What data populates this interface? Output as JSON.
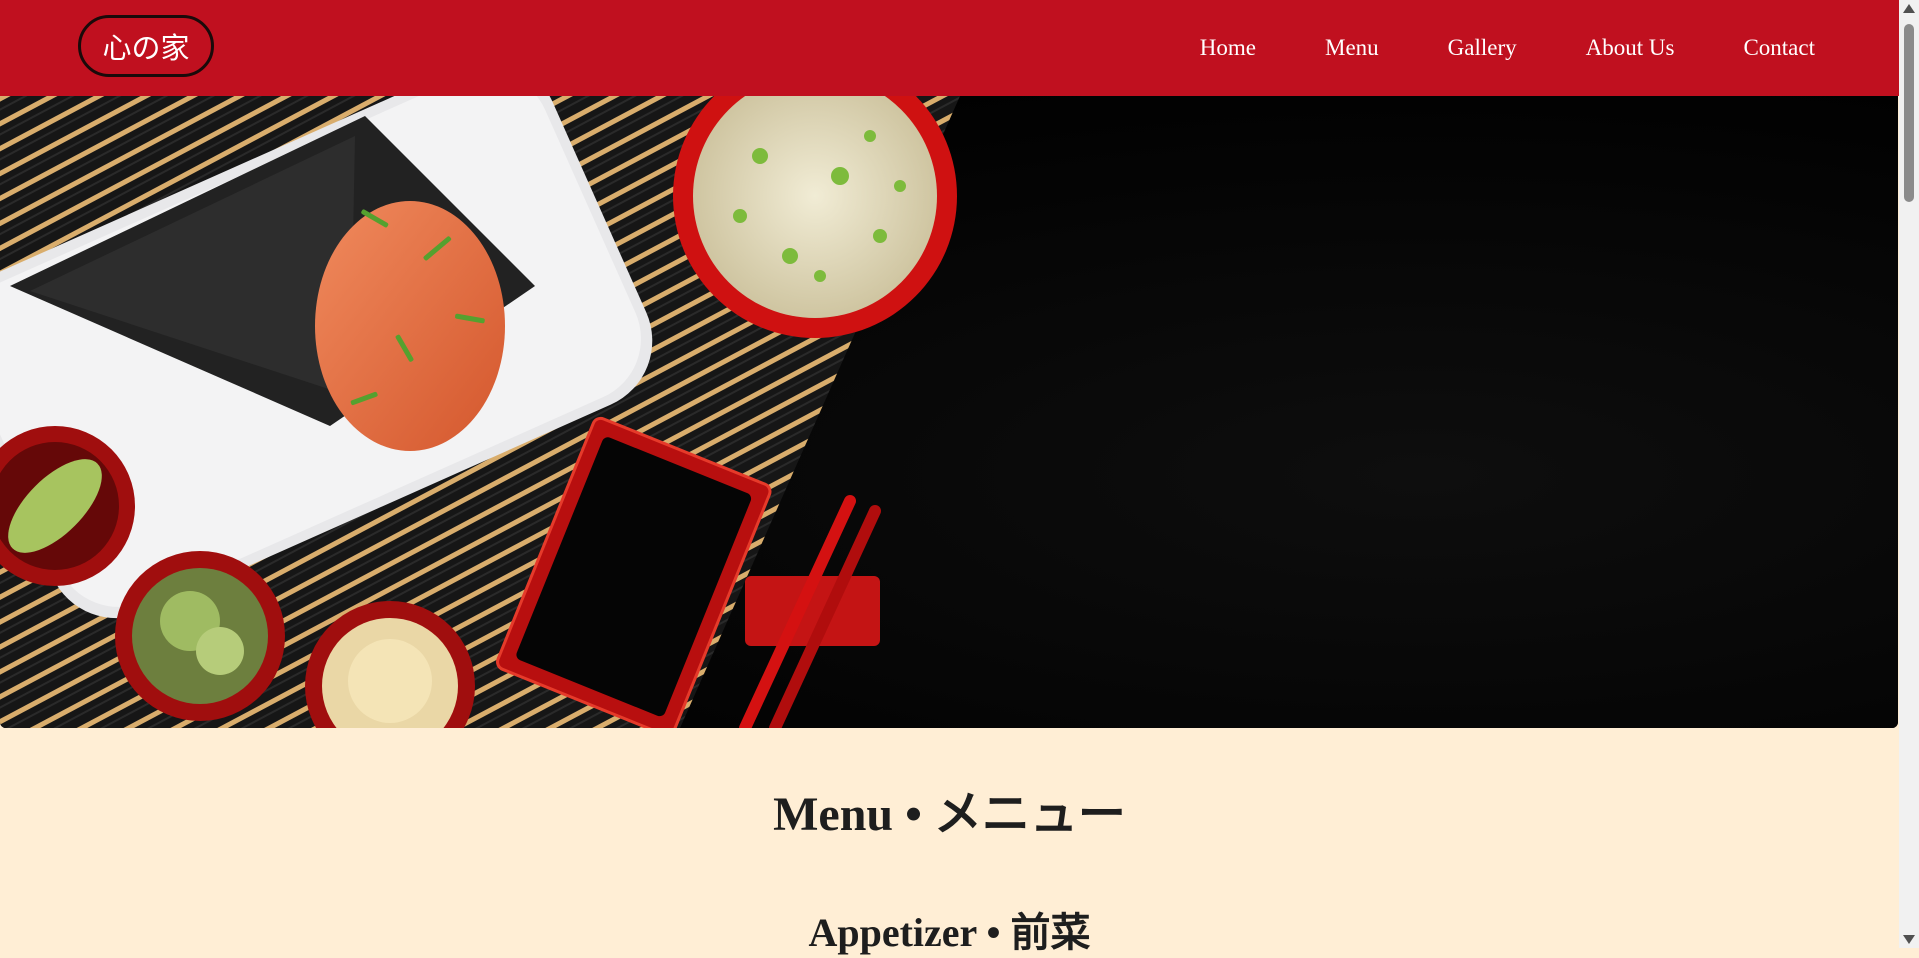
{
  "header": {
    "logo_text": "心の家",
    "nav": [
      "Home",
      "Menu",
      "Gallery",
      "About Us",
      "Contact"
    ],
    "brand_color": "#c0101f"
  },
  "hero": {
    "image_description": "sushi hand roll, miso soup, soy sauce dish and chopsticks on bamboo mat against black background"
  },
  "content": {
    "page_title": "Menu • メニュー",
    "sections": [
      {
        "title": "Appetizer • 前菜"
      }
    ],
    "background_color": "#ffeed5"
  }
}
